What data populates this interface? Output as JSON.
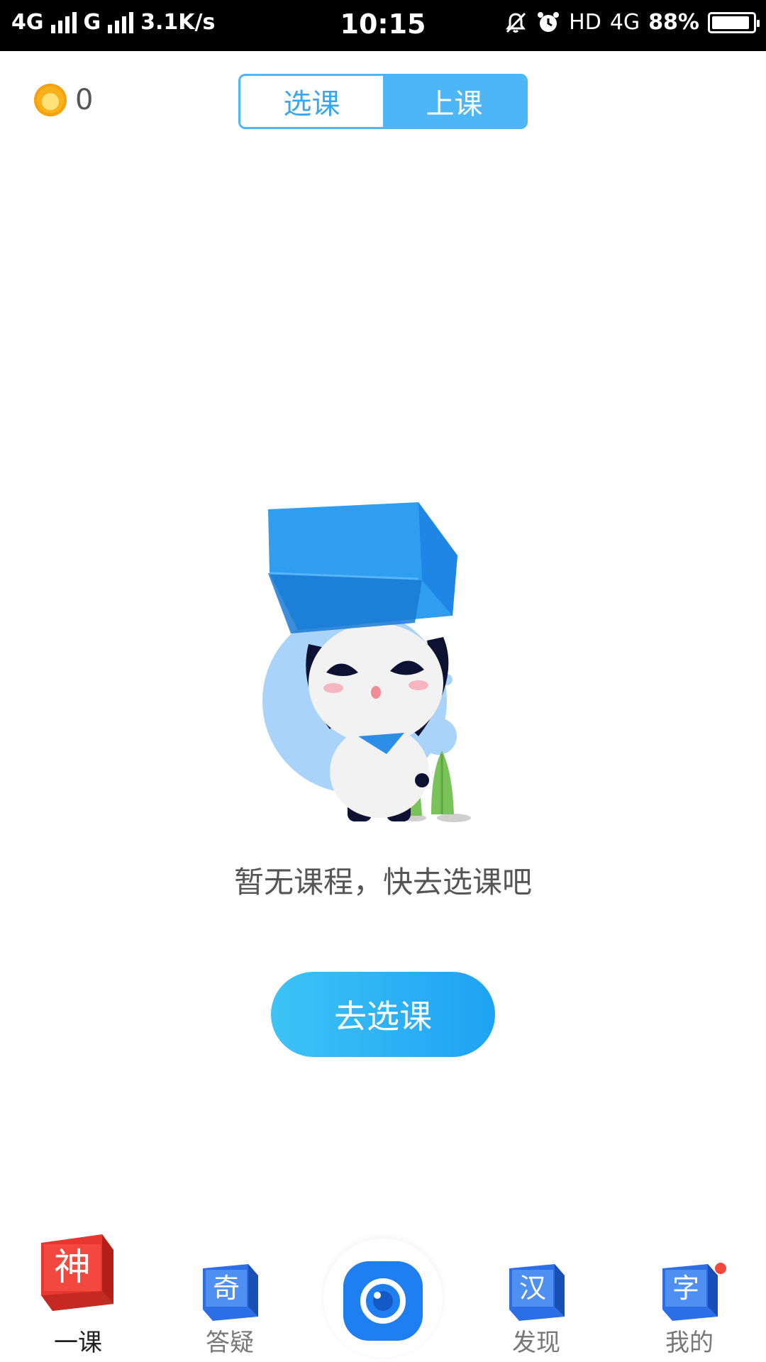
{
  "status_bar": {
    "network1": "4G",
    "network2": "G",
    "speed": "3.1K/s",
    "time": "10:15",
    "hd": "HD",
    "network3": "4G",
    "battery": "88%",
    "icons": [
      "mute-icon",
      "alarm-icon",
      "battery-icon"
    ]
  },
  "header": {
    "coin_count": "0",
    "coin_icon": "coin-icon",
    "tabs": [
      {
        "label": "选课",
        "active": false
      },
      {
        "label": "上课",
        "active": true
      }
    ]
  },
  "main": {
    "illustration": "panda-with-box-illustration",
    "empty_message": "暂无课程，快去选课吧",
    "cta_label": "去选课"
  },
  "tabbar": {
    "items": [
      {
        "label": "一课",
        "glyph": "神",
        "active": true
      },
      {
        "label": "答疑",
        "glyph": "奇",
        "active": false
      },
      {
        "label": "",
        "icon": "camera-icon",
        "active": false
      },
      {
        "label": "发现",
        "glyph": "汉",
        "active": false
      },
      {
        "label": "我的",
        "glyph": "字",
        "active": false,
        "badge": true
      }
    ]
  },
  "colors": {
    "accent": "#4cb6f6",
    "cta_start": "#3ec3f6",
    "cta_end": "#1ea2f4",
    "camera": "#1f7ef0",
    "badge": "#f2483d"
  }
}
